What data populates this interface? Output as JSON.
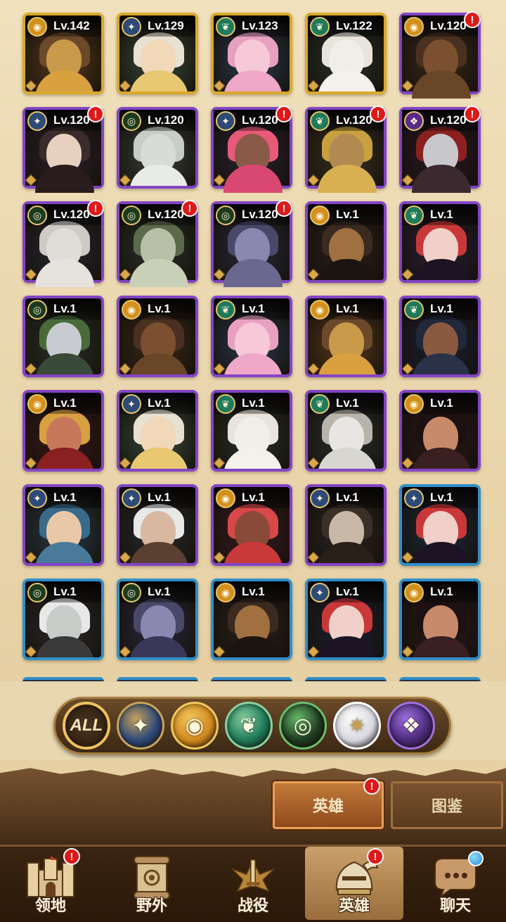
{
  "heroes": [
    {
      "level": "Lv.142",
      "faction": "lightbearer-gold",
      "frame": "gold",
      "alert": false,
      "palette": [
        "#5a3a1a",
        "#c89a4a",
        "#6a4a2a",
        "#d9a040"
      ]
    },
    {
      "level": "Lv.129",
      "faction": "lightbearer-blue",
      "frame": "gold",
      "alert": false,
      "palette": [
        "#3a4a3a",
        "#f0d8b8",
        "#e8e0d0",
        "#e8c870"
      ]
    },
    {
      "level": "Lv.123",
      "faction": "wilder",
      "frame": "gold",
      "alert": false,
      "palette": [
        "#2a3a4a",
        "#f6c8d8",
        "#e8a0c0",
        "#f0a8c8"
      ]
    },
    {
      "level": "Lv.122",
      "faction": "wilder",
      "frame": "gold",
      "alert": false,
      "palette": [
        "#2a3028",
        "#f0eee8",
        "#e8e4dc",
        "#f4f0ea"
      ]
    },
    {
      "level": "Lv.120",
      "faction": "lightbearer-gold",
      "frame": "purple",
      "alert": true,
      "palette": [
        "#3a2818",
        "#7a5030",
        "#4a3020",
        "#6a4628"
      ]
    },
    {
      "level": "Lv.120",
      "faction": "lightbearer-blue",
      "frame": "purple",
      "alert": true,
      "palette": [
        "#2a2028",
        "#e8d0c0",
        "#3a2c2c",
        "#2a1c1c"
      ]
    },
    {
      "level": "Lv.120",
      "faction": "graveborn",
      "frame": "purple",
      "alert": false,
      "palette": [
        "#3a4038",
        "#d8dcd8",
        "#c8ccc8",
        "#e8ece8"
      ]
    },
    {
      "level": "Lv.120",
      "faction": "lightbearer-blue",
      "frame": "purple",
      "alert": true,
      "palette": [
        "#2a2230",
        "#8a5a48",
        "#e85a7a",
        "#d84870"
      ]
    },
    {
      "level": "Lv.120",
      "faction": "wilder",
      "frame": "purple",
      "alert": true,
      "palette": [
        "#3a3020",
        "#b08a50",
        "#c8a040",
        "#d8b050"
      ]
    },
    {
      "level": "Lv.120",
      "faction": "mauler",
      "frame": "purple",
      "alert": true,
      "palette": [
        "#2a1820",
        "#c8c8cc",
        "#8a2020",
        "#3a2a30"
      ]
    },
    {
      "level": "Lv.120",
      "faction": "graveborn",
      "frame": "purple",
      "alert": true,
      "palette": [
        "#282830",
        "#e0dcd8",
        "#cfcac6",
        "#e6e2de"
      ]
    },
    {
      "level": "Lv.120",
      "faction": "graveborn",
      "frame": "purple",
      "alert": true,
      "palette": [
        "#2a3228",
        "#b8c0a8",
        "#5a6a4a",
        "#c8d0b8"
      ]
    },
    {
      "level": "Lv.120",
      "faction": "graveborn",
      "frame": "purple",
      "alert": true,
      "palette": [
        "#2a2a3a",
        "#8a88b0",
        "#4a4868",
        "#6a6890"
      ]
    },
    {
      "level": "Lv.1",
      "faction": "lightbearer-gold",
      "frame": "purple",
      "alert": false,
      "palette": [
        "#2a2018",
        "#a07040",
        "#3a2a20",
        "#1c1410"
      ]
    },
    {
      "level": "Lv.1",
      "faction": "wilder",
      "frame": "purple",
      "alert": false,
      "palette": [
        "#2a2034",
        "#f0d0c8",
        "#c83838",
        "#1c1424"
      ]
    },
    {
      "level": "Lv.1",
      "faction": "graveborn",
      "frame": "purple",
      "alert": false,
      "palette": [
        "#2a3028",
        "#c8ccd0",
        "#4a6a3a",
        "#3a4a38"
      ]
    },
    {
      "level": "Lv.1",
      "faction": "lightbearer-gold",
      "frame": "purple",
      "alert": false,
      "palette": [
        "#3a2818",
        "#7a5030",
        "#4a3020",
        "#6a4628"
      ]
    },
    {
      "level": "Lv.1",
      "faction": "wilder",
      "frame": "purple",
      "alert": false,
      "palette": [
        "#2a3a4a",
        "#f6c8d8",
        "#e8a0c0",
        "#f0a8c8"
      ]
    },
    {
      "level": "Lv.1",
      "faction": "lightbearer-gold",
      "frame": "purple",
      "alert": false,
      "palette": [
        "#5a3a1a",
        "#c89a4a",
        "#6a4a2a",
        "#d9a040"
      ]
    },
    {
      "level": "Lv.1",
      "faction": "wilder",
      "frame": "purple",
      "alert": false,
      "palette": [
        "#1c2030",
        "#8a5a40",
        "#20283a",
        "#2a3248"
      ]
    },
    {
      "level": "Lv.1",
      "faction": "lightbearer-gold",
      "frame": "purple",
      "alert": false,
      "palette": [
        "#3a1818",
        "#c8785a",
        "#d8a040",
        "#8a2020"
      ]
    },
    {
      "level": "Lv.1",
      "faction": "lightbearer-blue",
      "frame": "purple",
      "alert": false,
      "palette": [
        "#3a4a3a",
        "#f0d8b8",
        "#e8e0d0",
        "#e8c870"
      ]
    },
    {
      "level": "Lv.1",
      "faction": "wilder",
      "frame": "purple",
      "alert": false,
      "palette": [
        "#2a3028",
        "#f0eee8",
        "#e8e4dc",
        "#f4f0ea"
      ]
    },
    {
      "level": "Lv.1",
      "faction": "wilder",
      "frame": "purple",
      "alert": false,
      "palette": [
        "#2a3030",
        "#e8e6e2",
        "#b8b4ac",
        "#d8d6d0"
      ]
    },
    {
      "level": "Lv.1",
      "faction": "lightbearer-gold",
      "frame": "purple",
      "alert": false,
      "palette": [
        "#2a1818",
        "#c88a6a",
        "#1c1010",
        "#3a2020"
      ]
    },
    {
      "level": "Lv.1",
      "faction": "lightbearer-blue",
      "frame": "purple",
      "alert": false,
      "palette": [
        "#2a3a48",
        "#e8c8a8",
        "#3a6a8a",
        "#4a7a9a"
      ]
    },
    {
      "level": "Lv.1",
      "faction": "lightbearer-blue",
      "frame": "purple",
      "alert": false,
      "palette": [
        "#2a2a2a",
        "#d8b8a0",
        "#e8e8e8",
        "#5a4030"
      ]
    },
    {
      "level": "Lv.1",
      "faction": "lightbearer-gold",
      "frame": "purple",
      "alert": false,
      "palette": [
        "#3a1c20",
        "#8a4a3a",
        "#d84848",
        "#c83a3a"
      ]
    },
    {
      "level": "Lv.1",
      "faction": "lightbearer-blue",
      "frame": "purple",
      "alert": false,
      "palette": [
        "#2a2420",
        "#c8b8a8",
        "#3a3028",
        "#2a2018"
      ]
    },
    {
      "level": "Lv.1",
      "faction": "lightbearer-blue",
      "frame": "blue",
      "alert": false,
      "palette": [
        "#1c2a3a",
        "#f0d0c8",
        "#c83838",
        "#1c1424"
      ]
    },
    {
      "level": "Lv.1",
      "faction": "graveborn",
      "frame": "blue",
      "alert": false,
      "palette": [
        "#2a2a2a",
        "#c8ccc8",
        "#e8e8e8",
        "#3a3a3a"
      ]
    },
    {
      "level": "Lv.1",
      "faction": "graveborn",
      "frame": "blue",
      "alert": false,
      "palette": [
        "#2a2a3a",
        "#8a88b0",
        "#4a4868",
        "#3a3858"
      ]
    },
    {
      "level": "Lv.1",
      "faction": "lightbearer-gold",
      "frame": "blue",
      "alert": false,
      "palette": [
        "#2a2018",
        "#a07040",
        "#3a2a20",
        "#1c1410"
      ]
    },
    {
      "level": "Lv.1",
      "faction": "lightbearer-blue",
      "frame": "blue",
      "alert": false,
      "palette": [
        "#1c2030",
        "#f0d0c8",
        "#c83838",
        "#1c1424"
      ]
    },
    {
      "level": "Lv.1",
      "faction": "lightbearer-gold",
      "frame": "blue",
      "alert": false,
      "palette": [
        "#2a1818",
        "#c88a6a",
        "#1c1010",
        "#3a2020"
      ]
    }
  ],
  "faction_filter": {
    "all_label": "ALL",
    "buttons": [
      {
        "name": "lightbearer-blue",
        "glyph": "✦",
        "bg": "#2d4a78",
        "ring": "#c9a35c"
      },
      {
        "name": "lightbearer-gold",
        "glyph": "◉",
        "bg": "#d28a1e",
        "ring": "#f0c860"
      },
      {
        "name": "wilder",
        "glyph": "❦",
        "bg": "#1e7a5a",
        "ring": "#8ad0a0"
      },
      {
        "name": "graveborn",
        "glyph": "◎",
        "bg": "#1e3a22",
        "ring": "#6ac06a"
      },
      {
        "name": "celestial",
        "glyph": "✷",
        "bg": "#d8d8e0",
        "ring": "#ffffff"
      },
      {
        "name": "mauler",
        "glyph": "❖",
        "bg": "#4a2a7a",
        "ring": "#a070e0"
      }
    ]
  },
  "faction_badges": {
    "lightbearer-gold": {
      "glyph": "◉",
      "bg": "#d2901e"
    },
    "lightbearer-blue": {
      "glyph": "✦",
      "bg": "#2d4a78"
    },
    "wilder": {
      "glyph": "❦",
      "bg": "#1e7a5a"
    },
    "graveborn": {
      "glyph": "◎",
      "bg": "#1c3a1e"
    },
    "mauler": {
      "glyph": "❖",
      "bg": "#5a2a8a"
    }
  },
  "tabs": {
    "heroes": "英雄",
    "codex": "图鉴",
    "heroes_alert": "!"
  },
  "nav": {
    "territory": {
      "label": "领地",
      "alert": "!"
    },
    "field": {
      "label": "野外"
    },
    "campaign": {
      "label": "战役"
    },
    "heroes": {
      "label": "英雄",
      "alert": "!"
    },
    "chat": {
      "label": "聊天"
    }
  },
  "colors": {
    "frame_gold": "#d9a92a",
    "frame_purple": "#8344c6",
    "frame_blue": "#2f8fc9",
    "alert_red": "#e01818"
  }
}
